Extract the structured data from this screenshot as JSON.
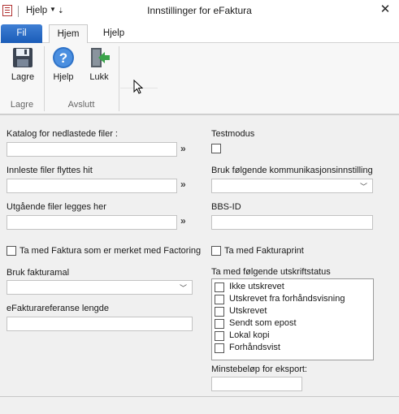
{
  "titlebar": {
    "menu_label": "Hjelp",
    "window_title": "Innstillinger for eFaktura",
    "close_glyph": "✕"
  },
  "tabs": [
    "Fil",
    "Hjem",
    "Hjelp"
  ],
  "ribbon": {
    "buttons": [
      {
        "label": "Lagre",
        "icon": "save-icon"
      },
      {
        "label": "Hjelp",
        "icon": "help-icon"
      },
      {
        "label": "Lukk",
        "icon": "exit-icon"
      }
    ],
    "groups": [
      "Lagre",
      "Avslutt"
    ]
  },
  "form": {
    "catalog_label": "Katalog for nedlastede filer :",
    "catalog_value": "",
    "imported_label": "Innleste filer flyttes hit",
    "imported_value": "",
    "outgoing_label": "Utgående filer legges her",
    "outgoing_value": "",
    "browse_glyph": "»",
    "factoring_label": "Ta med Faktura som er merket med Factoring",
    "template_label": "Bruk fakturamal",
    "template_value": "",
    "ref_length_label": "eFakturareferanse lengde",
    "ref_length_value": "",
    "testmode_label": "Testmodus",
    "comm_label": "Bruk følgende kommunikasjonsinnstilling",
    "comm_value": "",
    "bbs_label": "BBS-ID",
    "bbs_value": "",
    "print_label": "Ta med Fakturaprint",
    "status_label": "Ta med følgende utskriftstatus",
    "statuses": [
      "Ikke utskrevet",
      "Utskrevet fra forhåndsvisning",
      "Utskrevet",
      "Sendt som epost",
      "Lokal kopi",
      "Forhåndsvist"
    ],
    "min_amount_label": "Minstebeløp for eksport:",
    "min_amount_value": ""
  }
}
